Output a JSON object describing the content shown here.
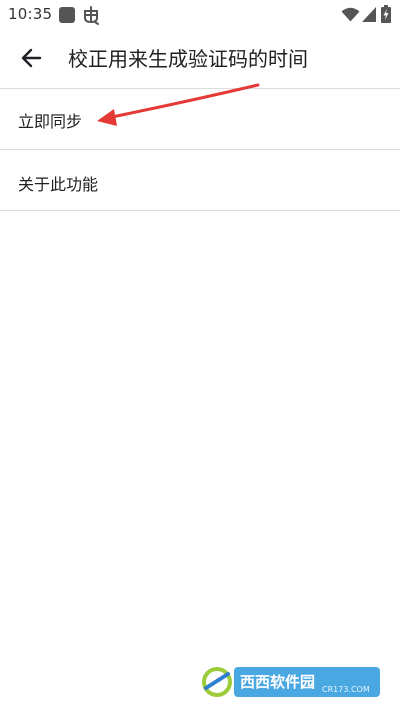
{
  "status_bar": {
    "time": "10:35",
    "icons": [
      "app-notification-icon",
      "bug-icon",
      "wifi-icon",
      "signal-icon",
      "battery-charging-icon"
    ]
  },
  "app_bar": {
    "back_icon": "arrow-back-icon",
    "title": "校正用来生成验证码的时间"
  },
  "menu": {
    "items": [
      {
        "label": "立即同步"
      },
      {
        "label": "关于此功能"
      }
    ]
  },
  "annotation": {
    "arrow_color": "#e53935"
  },
  "watermark": {
    "brand": "西西软件园",
    "domain": "CR173.COM"
  },
  "colors": {
    "text_primary": "#202124",
    "divider": "#dcdcdc",
    "background": "#ffffff"
  }
}
